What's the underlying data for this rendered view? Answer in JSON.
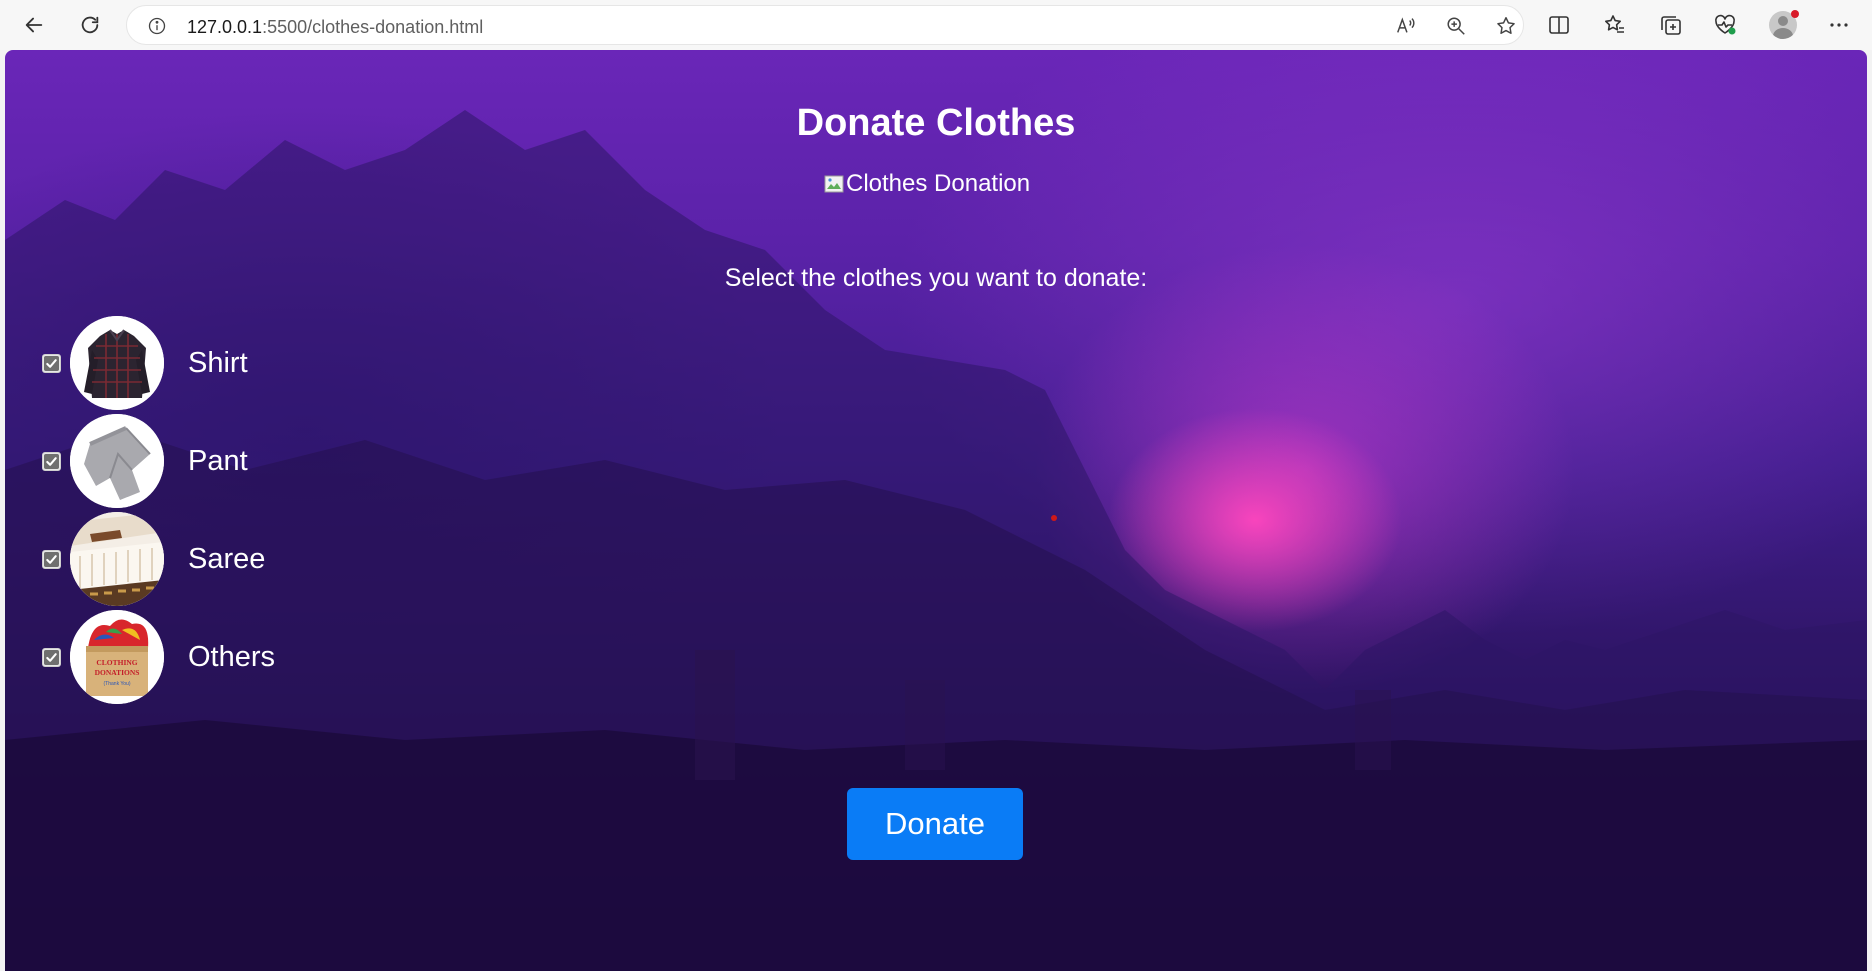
{
  "browser": {
    "url_host": "127.0.0.1",
    "url_path": ":5500/clothes-donation.html",
    "icons": [
      "back-icon",
      "reload-icon",
      "site-info-icon",
      "read-aloud-icon",
      "zoom-icon",
      "favorite-star-icon",
      "split-screen-icon",
      "favorites-icon",
      "collections-icon",
      "browser-essentials-icon",
      "profile-avatar-icon",
      "more-menu-icon"
    ]
  },
  "page": {
    "title": "Donate Clothes",
    "image_alt": "Clothes Donation",
    "prompt": "Select the clothes you want to donate:",
    "items": [
      {
        "label": "Shirt",
        "checked": true
      },
      {
        "label": "Pant",
        "checked": true
      },
      {
        "label": "Saree",
        "checked": true
      },
      {
        "label": "Others",
        "checked": true
      }
    ],
    "others_box_text": [
      "CLOTHING",
      "DONATIONS",
      "(Thank You)"
    ],
    "donate_label": "Donate"
  },
  "colors": {
    "button_blue": "#0a7cf6",
    "bg_purple": "#5a22a8",
    "glow_pink": "#ff46be"
  }
}
